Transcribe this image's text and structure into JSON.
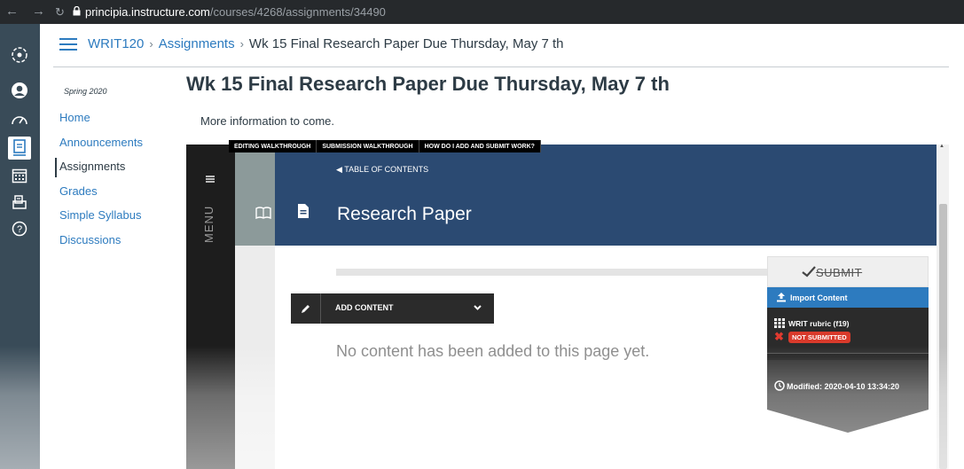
{
  "browser": {
    "url_domain": "principia.instructure.com",
    "url_path": "/courses/4268/assignments/34490"
  },
  "breadcrumb": {
    "course": "WRIT120",
    "section": "Assignments",
    "current": "Wk 15 Final Research Paper Due Thursday, May 7 th"
  },
  "course_nav": {
    "term": "Spring 2020",
    "items": [
      {
        "label": "Home"
      },
      {
        "label": "Announcements"
      },
      {
        "label": "Assignments"
      },
      {
        "label": "Grades"
      },
      {
        "label": "Simple Syllabus"
      },
      {
        "label": "Discussions"
      }
    ]
  },
  "page": {
    "title": "Wk 15 Final Research Paper Due Thursday, May 7 th",
    "description": "More information to come."
  },
  "tool": {
    "walkthrough_links": [
      "EDITING WALKTHROUGH",
      "SUBMISSION WALKTHROUGH",
      "HOW DO I ADD AND SUBMIT WORK?"
    ],
    "menu_label": "MENU",
    "toc_label": "TABLE OF CONTENTS",
    "doc_title": "Research Paper",
    "add_content_label": "ADD CONTENT",
    "empty_message": "No content has been added to this page yet.",
    "submit_label": "SUBMIT",
    "import_label": "Import Content",
    "rubric_label": "WRIT rubric (f19)",
    "status_badge": "NOT SUBMITTED",
    "modified_label": "Modified: 2020-04-10 13:34:20"
  },
  "colors": {
    "canvas_nav": "#394b58",
    "link_blue": "#2d7bbf",
    "tool_header_blue": "#2b4a72",
    "badge_red": "#d93a2b"
  }
}
